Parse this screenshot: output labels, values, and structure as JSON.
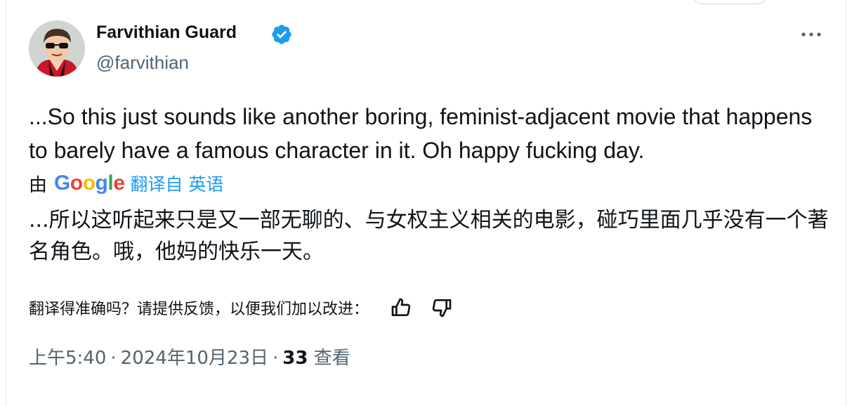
{
  "author": {
    "name": "Farvithian Guard",
    "handle": "@farvithian",
    "verified_icon": "verified-badge-icon",
    "verified_color": "#1d9bf0"
  },
  "tweet": {
    "text": "...So this just sounds like another boring, feminist-adjacent movie that happens to barely have a famous character in it. Oh happy fucking day."
  },
  "translation": {
    "by_label": "由",
    "provider": "Google",
    "from_label": "翻译自 英语",
    "text": "...所以这听起来只是又一部无聊的、与女权主义相关的电影，碰巧里面几乎没有一个著名角色。哦，他妈的快乐一天。",
    "feedback_prompt": "翻译得准确吗？请提供反馈，以便我们加以改进：",
    "thumbs_up_icon": "thumbs-up-icon",
    "thumbs_down_icon": "thumbs-down-icon"
  },
  "meta": {
    "time": "上午5:40",
    "separator": "·",
    "date": "2024年10月23日",
    "views_count": "33",
    "views_label": "查看"
  },
  "colors": {
    "accent": "#1d9bf0",
    "text": "#0f1419",
    "secondary": "#536471"
  }
}
